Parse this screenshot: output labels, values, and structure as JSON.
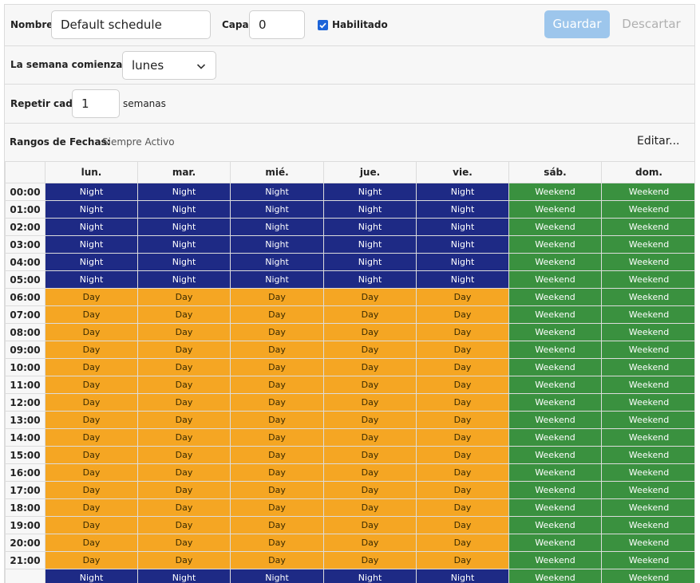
{
  "header": {
    "name_label": "Nombre",
    "name_value": "Default schedule",
    "layer_label": "Capa",
    "layer_value": "0",
    "enabled_label": "Habilitado",
    "enabled_checked": true,
    "save_label": "Guardar",
    "discard_label": "Descartar"
  },
  "week_start": {
    "label": "La semana comienza el",
    "value": "lunes"
  },
  "repeat": {
    "label": "Repetir cada",
    "value": "1",
    "unit": "semanas"
  },
  "date_ranges": {
    "label": "Rangos de Fechas:",
    "value": "Siempre Activo",
    "edit_label": "Editar..."
  },
  "colors": {
    "night": "#1e2a85",
    "day": "#f5a623",
    "weekend": "#3a913f",
    "save_button": "#9dc6ec",
    "checkbox": "#1d64d8"
  },
  "grid": {
    "days": [
      "lun.",
      "mar.",
      "mié.",
      "jue.",
      "vie.",
      "sáb.",
      "dom."
    ],
    "hours": [
      "00:00",
      "01:00",
      "02:00",
      "03:00",
      "04:00",
      "05:00",
      "06:00",
      "07:00",
      "08:00",
      "09:00",
      "10:00",
      "11:00",
      "12:00",
      "13:00",
      "14:00",
      "15:00",
      "16:00",
      "17:00",
      "18:00",
      "19:00",
      "20:00",
      "21:00"
    ],
    "rows": [
      [
        "Night",
        "Night",
        "Night",
        "Night",
        "Night",
        "Weekend",
        "Weekend"
      ],
      [
        "Night",
        "Night",
        "Night",
        "Night",
        "Night",
        "Weekend",
        "Weekend"
      ],
      [
        "Night",
        "Night",
        "Night",
        "Night",
        "Night",
        "Weekend",
        "Weekend"
      ],
      [
        "Night",
        "Night",
        "Night",
        "Night",
        "Night",
        "Weekend",
        "Weekend"
      ],
      [
        "Night",
        "Night",
        "Night",
        "Night",
        "Night",
        "Weekend",
        "Weekend"
      ],
      [
        "Night",
        "Night",
        "Night",
        "Night",
        "Night",
        "Weekend",
        "Weekend"
      ],
      [
        "Day",
        "Day",
        "Day",
        "Day",
        "Day",
        "Weekend",
        "Weekend"
      ],
      [
        "Day",
        "Day",
        "Day",
        "Day",
        "Day",
        "Weekend",
        "Weekend"
      ],
      [
        "Day",
        "Day",
        "Day",
        "Day",
        "Day",
        "Weekend",
        "Weekend"
      ],
      [
        "Day",
        "Day",
        "Day",
        "Day",
        "Day",
        "Weekend",
        "Weekend"
      ],
      [
        "Day",
        "Day",
        "Day",
        "Day",
        "Day",
        "Weekend",
        "Weekend"
      ],
      [
        "Day",
        "Day",
        "Day",
        "Day",
        "Day",
        "Weekend",
        "Weekend"
      ],
      [
        "Day",
        "Day",
        "Day",
        "Day",
        "Day",
        "Weekend",
        "Weekend"
      ],
      [
        "Day",
        "Day",
        "Day",
        "Day",
        "Day",
        "Weekend",
        "Weekend"
      ],
      [
        "Day",
        "Day",
        "Day",
        "Day",
        "Day",
        "Weekend",
        "Weekend"
      ],
      [
        "Day",
        "Day",
        "Day",
        "Day",
        "Day",
        "Weekend",
        "Weekend"
      ],
      [
        "Day",
        "Day",
        "Day",
        "Day",
        "Day",
        "Weekend",
        "Weekend"
      ],
      [
        "Day",
        "Day",
        "Day",
        "Day",
        "Day",
        "Weekend",
        "Weekend"
      ],
      [
        "Day",
        "Day",
        "Day",
        "Day",
        "Day",
        "Weekend",
        "Weekend"
      ],
      [
        "Day",
        "Day",
        "Day",
        "Day",
        "Day",
        "Weekend",
        "Weekend"
      ],
      [
        "Day",
        "Day",
        "Day",
        "Day",
        "Day",
        "Weekend",
        "Weekend"
      ],
      [
        "Day",
        "Day",
        "Day",
        "Day",
        "Day",
        "Weekend",
        "Weekend"
      ],
      [
        "Night",
        "Night",
        "Night",
        "Night",
        "Night",
        "Weekend",
        "Weekend"
      ]
    ]
  }
}
